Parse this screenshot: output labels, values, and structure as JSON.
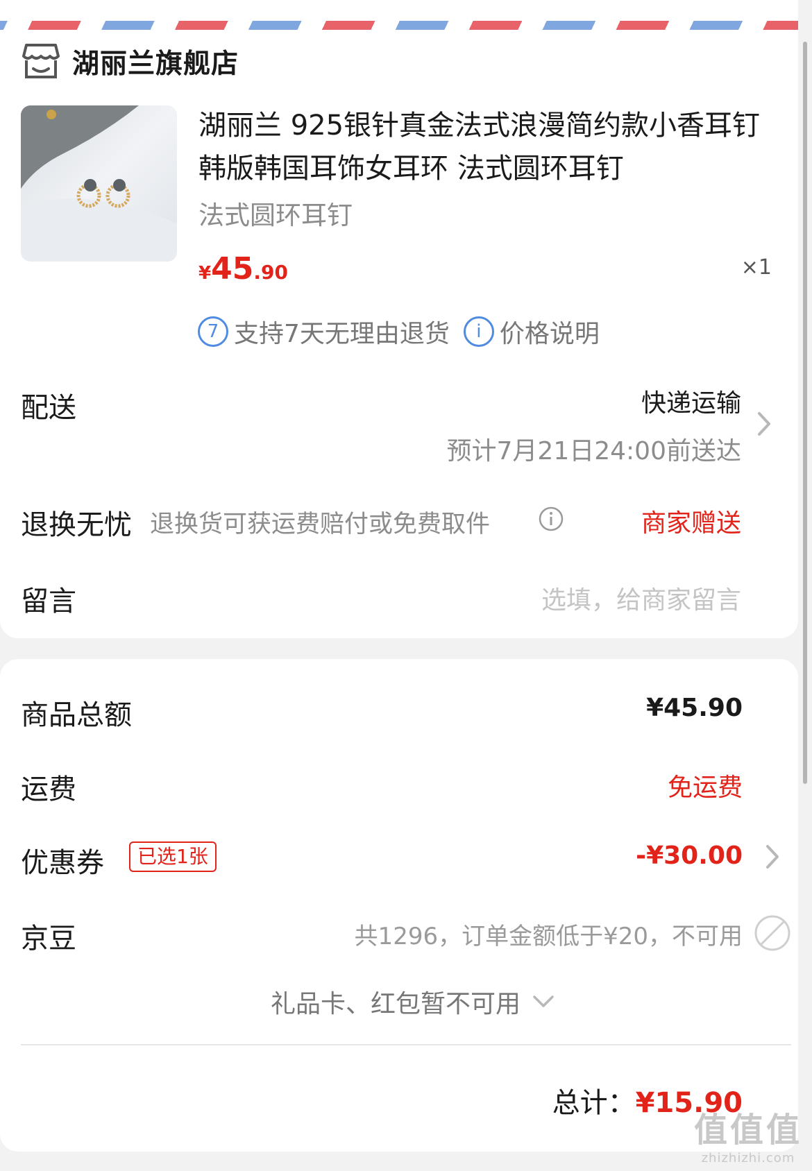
{
  "store": {
    "name": "湖丽兰旗舰店",
    "icon": "store-icon"
  },
  "product": {
    "title": "湖丽兰 925银针真金法式浪漫简约款小香耳钉韩版韩国耳饰女耳环 法式圆环耳钉",
    "variant": "法式圆环耳钉",
    "price_currency": "¥",
    "price_int": "45",
    "price_dec": ".90",
    "quantity": "×1",
    "image": "earring-product-photo",
    "services": [
      {
        "icon": "seven-day-return-icon",
        "icon_glyph": "7",
        "label": "支持7天无理由退货"
      },
      {
        "icon": "info-icon",
        "icon_glyph": "i",
        "label": "价格说明"
      }
    ]
  },
  "delivery": {
    "label": "配送",
    "method": "快递运输",
    "estimate": "预计7月21日24:00前送达"
  },
  "return_worry_free": {
    "label": "退换无忧",
    "desc": "退换货可获运费赔付或免费取件",
    "value": "商家赠送"
  },
  "message": {
    "label": "留言",
    "placeholder": "选填，给商家留言"
  },
  "summary": {
    "goods_total_label": "商品总额",
    "goods_total_value": "¥45.90",
    "shipping_label": "运费",
    "shipping_value": "免运费",
    "coupon_label": "优惠券",
    "coupon_badge": "已选1张",
    "coupon_value": "-¥30.00",
    "jingdou_label": "京豆",
    "jingdou_desc": "共1296，订单金额低于¥20，不可用",
    "gift_card_text": "礼品卡、红包暂不可用",
    "total_label": "总计：",
    "total_value": "¥15.90"
  },
  "watermark": {
    "big": "值值值",
    "small": "zhizhizhi.com"
  },
  "colors": {
    "accent_red": "#e2231a",
    "info_blue": "#4f8be0",
    "stripe_red": "#e8626a",
    "stripe_blue": "#7fa6de"
  }
}
